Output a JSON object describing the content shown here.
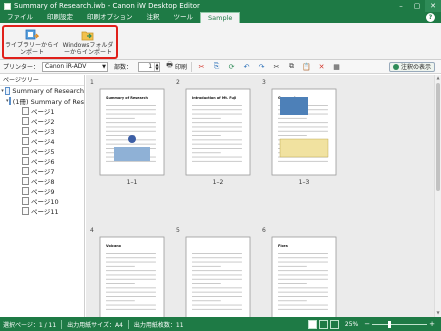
{
  "window": {
    "title": "Summary of Research.iwb - Canon iW Desktop   Editor",
    "buttons": [
      "–",
      "▢",
      "✕"
    ]
  },
  "menubar": {
    "items": [
      {
        "label": "ファイル"
      },
      {
        "label": "印刷設定"
      },
      {
        "label": "印刷オプション"
      },
      {
        "label": "注釈"
      },
      {
        "label": "ツール"
      },
      {
        "label": "Sample",
        "active": true
      }
    ],
    "help": "?"
  },
  "ribbon": {
    "buttons": [
      {
        "label": "ライブラリーからインポート",
        "icon": "library-import-icon"
      },
      {
        "label": "Windowsフォルダーからインポート",
        "icon": "folder-import-icon"
      }
    ]
  },
  "toolbar": {
    "printer_label": "プリンター：",
    "printer_value": "Canon iR-ADV",
    "copies_label": "部数：",
    "copies_value": "1",
    "print_label": "印刷",
    "notes_label": "注釈の表示"
  },
  "tree": {
    "header": "ページツリー",
    "root": "Summary of Research",
    "doc": "(1冊) Summary of Res",
    "pages": [
      "ページ1",
      "ページ2",
      "ページ3",
      "ページ4",
      "ページ5",
      "ページ6",
      "ページ7",
      "ページ8",
      "ページ9",
      "ページ10",
      "ページ11"
    ]
  },
  "canvas": {
    "pages": [
      {
        "num": "1",
        "label": "1–1",
        "title": "Summary of Research"
      },
      {
        "num": "2",
        "label": "1–2",
        "title": "Introduction of Mt. Fuji"
      },
      {
        "num": "3",
        "label": "1–3",
        "title": "Geography"
      },
      {
        "num": "4",
        "label": "",
        "title": "Volcano"
      },
      {
        "num": "5",
        "label": "",
        "title": ""
      },
      {
        "num": "6",
        "label": "",
        "title": "Flora"
      }
    ]
  },
  "status": {
    "selected_pages": "選択ページ：1 / 11",
    "paper_size": "出力用紙サイズ：A4",
    "output_pages": "出力用紙枚数：11",
    "zoom": "25%"
  },
  "colors": {
    "accent": "#1e7a45",
    "highlight": "#e0201a"
  }
}
